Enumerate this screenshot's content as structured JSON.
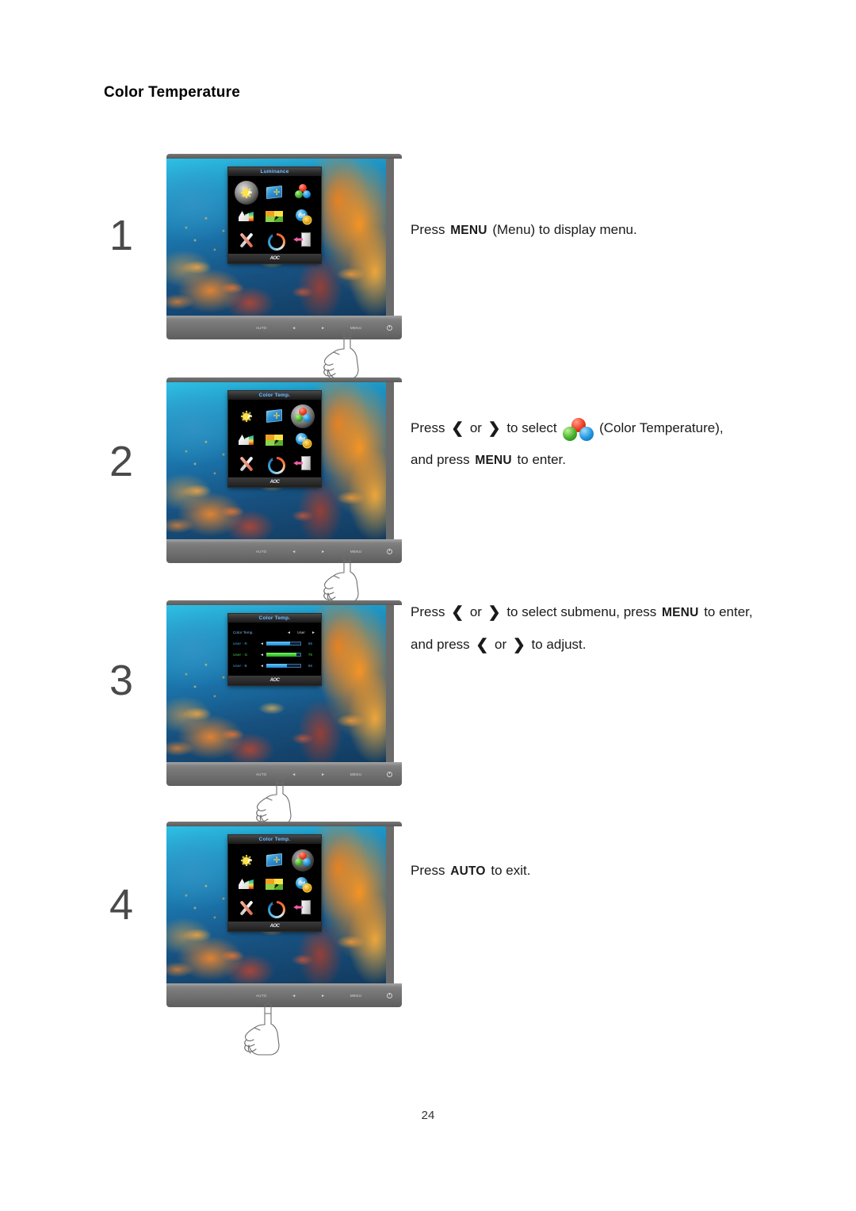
{
  "document": {
    "heading": "Color Temperature",
    "page_number": "24"
  },
  "keys": {
    "menu": "MENU",
    "auto": "AUTO",
    "left": "❮",
    "right": "❯"
  },
  "monitor": {
    "brand": "AOC",
    "bezel_buttons": [
      "AUTO",
      "◄",
      "►",
      "MENU"
    ],
    "power_icon": "power-icon"
  },
  "osd": {
    "main_title_step1": "Luminance",
    "main_title_selected": "Color Temp.",
    "icons": [
      {
        "name": "luminance-icon",
        "label": "Luminance"
      },
      {
        "name": "image-setup-icon",
        "label": "Image Setup"
      },
      {
        "name": "color-temp-icon",
        "label": "Color Temp."
      },
      {
        "name": "picture-boost-icon",
        "label": "Picture Boost"
      },
      {
        "name": "osd-setup-icon",
        "label": "OSD Setup"
      },
      {
        "name": "extra-icon",
        "label": "Extra"
      },
      {
        "name": "reset-icon",
        "label": "Reset"
      },
      {
        "name": "refresh-icon",
        "label": "Reset"
      },
      {
        "name": "exit-icon",
        "label": "Exit"
      }
    ],
    "submenu": {
      "title": "Color Temp.",
      "rows": [
        {
          "label": "Color Temp.",
          "type": "option",
          "left": "◄",
          "value": "User",
          "right": "►"
        },
        {
          "label": "User - R",
          "type": "slider",
          "left": "◄",
          "value": "69",
          "fill": 68
        },
        {
          "label": "User - G",
          "type": "slider",
          "left": "◄",
          "value": "79",
          "fill": 86
        },
        {
          "label": "User - B",
          "type": "slider",
          "left": "◄",
          "value": "59",
          "fill": 58
        }
      ]
    }
  },
  "steps": [
    {
      "number": "1",
      "instruction_parts": [
        {
          "t": "text",
          "v": "Press "
        },
        {
          "t": "key",
          "v": "MENU"
        },
        {
          "t": "text",
          "v": " (Menu) to display menu."
        }
      ]
    },
    {
      "number": "2",
      "instruction_parts": [
        {
          "t": "text",
          "v": "Press "
        },
        {
          "t": "chev",
          "v": "❮"
        },
        {
          "t": "text",
          "v": " or "
        },
        {
          "t": "chev",
          "v": "❯"
        },
        {
          "t": "text",
          "v": " to select "
        },
        {
          "t": "rgb",
          "v": "color-temp-icon"
        },
        {
          "t": "text",
          "v": " (Color Temperature), and press "
        },
        {
          "t": "key",
          "v": "MENU"
        },
        {
          "t": "text",
          "v": " to enter."
        }
      ]
    },
    {
      "number": "3",
      "instruction_parts": [
        {
          "t": "text",
          "v": "Press "
        },
        {
          "t": "chev",
          "v": "❮"
        },
        {
          "t": "text",
          "v": " or "
        },
        {
          "t": "chev",
          "v": "❯"
        },
        {
          "t": "text",
          "v": " to select submenu, press "
        },
        {
          "t": "key",
          "v": "MENU"
        },
        {
          "t": "text",
          "v": " to enter, and press "
        },
        {
          "t": "chev",
          "v": "❮"
        },
        {
          "t": "text",
          "v": " or "
        },
        {
          "t": "chev",
          "v": "❯"
        },
        {
          "t": "text",
          "v": " to adjust."
        }
      ]
    },
    {
      "number": "4",
      "instruction_parts": [
        {
          "t": "text",
          "v": "Press "
        },
        {
          "t": "key",
          "v": "AUTO"
        },
        {
          "t": "text",
          "v": " to exit."
        }
      ]
    }
  ],
  "colors": {
    "red_sphere": "#ec3a1d",
    "green_sphere": "#45b02c",
    "blue_sphere": "#1f95df",
    "osd_title_text": "#7fb7e8",
    "bezel": "#6e6e6e"
  }
}
